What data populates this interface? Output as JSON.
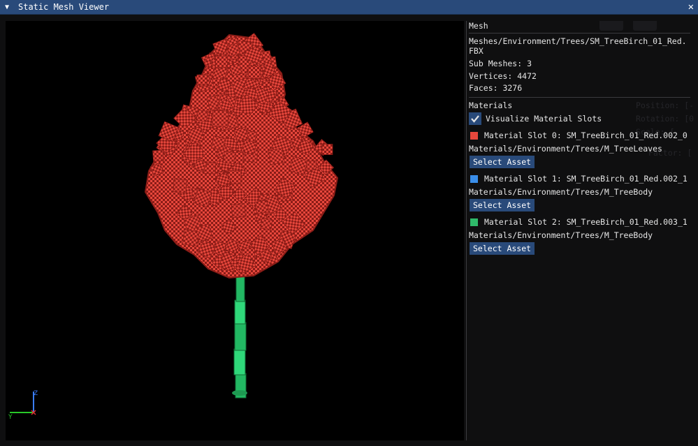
{
  "window": {
    "title": "Static Mesh Viewer",
    "collapse_glyph": "▼",
    "close_glyph": "✕"
  },
  "viewport": {
    "axis_labels": {
      "z": "Z",
      "y": "Y",
      "x": "X"
    },
    "colors": {
      "leaves": "#e8473c",
      "leaves_dark": "#8a1c17",
      "trunk": "#2fd87a",
      "trunk_dark": "#126b36",
      "axis_z": "#3a7dff",
      "axis_y": "#28c828",
      "axis_x": "#e03030"
    }
  },
  "mesh_section": {
    "header": "Mesh",
    "path": "Meshes/Environment/Trees/SM_TreeBirch_01_Red.FBX",
    "sub_meshes": "Sub Meshes: 3",
    "vertices": "Vertices: 4472",
    "faces": "Faces: 3276"
  },
  "materials_section": {
    "header": "Materials",
    "visualize_label": "Visualize Material Slots",
    "visualize_checked": true,
    "slots": [
      {
        "label": "Material Slot 0: SM_TreeBirch_01_Red.002_0",
        "path": "Materials/Environment/Trees/M_TreeLeaves",
        "button": "Select Asset",
        "color": "#e8473c"
      },
      {
        "label": "Material Slot 1: SM_TreeBirch_01_Red.002_1",
        "path": "Materials/Environment/Trees/M_TreeBody",
        "button": "Select Asset",
        "color": "#3a8eea"
      },
      {
        "label": "Material Slot 2: SM_TreeBirch_01_Red.003_1",
        "path": "Materials/Environment/Trees/M_TreeBody",
        "button": "Select Asset",
        "color": "#2fba6a"
      }
    ]
  },
  "background_ghost": {
    "position": "Position: [-",
    "rotation": "Rotation: [0",
    "scale": "Scale: [",
    "factor": "Factor: ["
  }
}
